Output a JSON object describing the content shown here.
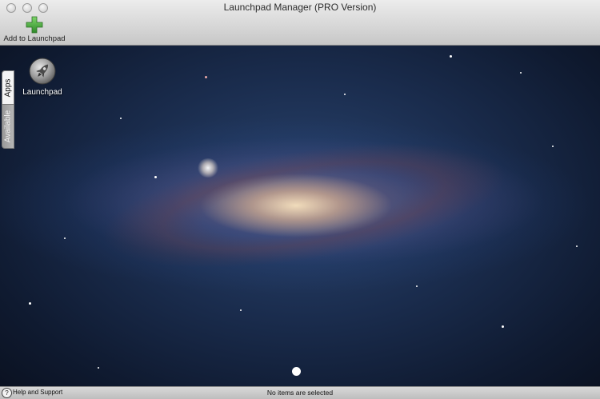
{
  "window": {
    "title": "Launchpad Manager (PRO Version)"
  },
  "toolbar": {
    "add_button": {
      "label": "Add to Launchpad",
      "icon": "plus-icon",
      "icon_color": "#3fa535"
    }
  },
  "side_tabs": [
    {
      "label": "Apps",
      "selected": true
    },
    {
      "label": "Available",
      "selected": false
    }
  ],
  "apps": [
    {
      "label": "Launchpad",
      "icon": "rocket-icon"
    }
  ],
  "pagination": {
    "pages": 1,
    "current": 1
  },
  "statusbar": {
    "help_label": "Help and Support",
    "help_icon": "question-icon",
    "status_text": "No items are selected"
  },
  "colors": {
    "toolbar_bg": "#d8d8d8",
    "wallpaper_dark": "#0f1a30",
    "wallpaper_core": "#f7e2be"
  }
}
